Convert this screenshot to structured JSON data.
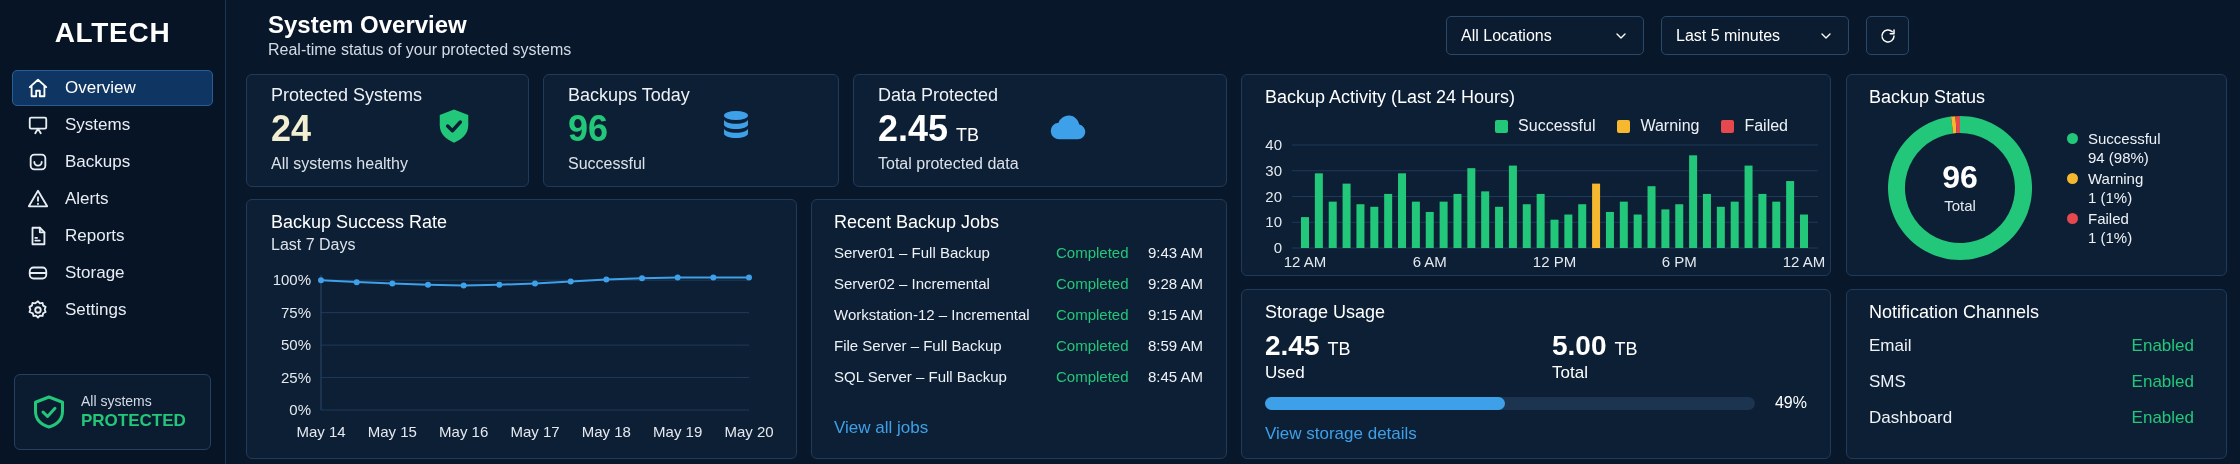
{
  "sidebar": {
    "logo": "ALTECH",
    "items": [
      {
        "label": "Overview",
        "selected": true
      },
      {
        "label": "Systems",
        "selected": false
      },
      {
        "label": "Backups",
        "selected": false
      },
      {
        "label": "Alerts",
        "selected": false
      },
      {
        "label": "Reports",
        "selected": false
      },
      {
        "label": "Storage",
        "selected": false
      },
      {
        "label": "Settings",
        "selected": false
      }
    ],
    "status_card": {
      "label": "All systems",
      "status": "PROTECTED"
    }
  },
  "header": {
    "title": "System Overview",
    "subtitle": "Real-time status of your protected systems",
    "filters": [
      {
        "value": "All Locations"
      },
      {
        "value": "Last 5 minutes"
      }
    ]
  },
  "stat_cards": [
    {
      "kind": "shield",
      "title": "Protected Systems",
      "value": "24",
      "color": "#f2eed2",
      "caption": "All systems healthy"
    },
    {
      "kind": "database",
      "title": "Backups Today",
      "value": "96",
      "color": "#22c77a",
      "caption": "Successful"
    },
    {
      "kind": "cloud",
      "title": "Data Protected",
      "value": "2.45",
      "unit": "TB",
      "color": "#ffffff",
      "caption": "Total protected data"
    }
  ],
  "success_rate": {
    "title": "Backup Success Rate",
    "subtitle": "Last 7 Days",
    "chart_data": {
      "type": "line",
      "categories": [
        "May 14",
        null,
        "May 15",
        null,
        "May 16",
        null,
        "May 17",
        null,
        "May 18",
        null,
        "May 19",
        null,
        "May 20"
      ],
      "grid": true,
      "series": [
        {
          "color": "#3ea0e8",
          "marker": "circle",
          "values": [
            100,
            98.5,
            97.5,
            96.5,
            96,
            96.5,
            97.5,
            99,
            100.5,
            101.5,
            102,
            102,
            102
          ]
        }
      ],
      "ylim": [
        0,
        104
      ],
      "yticks": [
        {
          "value": 0,
          "label": "0%"
        },
        {
          "value": 25,
          "label": "25%"
        },
        {
          "value": 50,
          "label": "50%"
        },
        {
          "value": 75,
          "label": "75%"
        },
        {
          "value": 100,
          "label": "100%"
        }
      ]
    }
  },
  "recent_jobs": {
    "title": "Recent Backup Jobs",
    "jobs": [
      {
        "name": "Server01 – Full Backup",
        "status": "Completed",
        "time": "9:43 AM"
      },
      {
        "name": "Server02 – Incremental",
        "status": "Completed",
        "time": "9:28 AM"
      },
      {
        "name": "Workstation-12 – Incremental",
        "status": "Completed",
        "time": "9:15 AM"
      },
      {
        "name": "File Server – Full Backup",
        "status": "Completed",
        "time": "8:59 AM"
      },
      {
        "name": "SQL Server – Full Backup",
        "status": "Completed",
        "time": "8:45 AM"
      }
    ],
    "link": "View all jobs"
  },
  "backup_activity": {
    "title": "Backup Activity (Last 24 Hours)",
    "chart_data": {
      "type": "bar",
      "stacked": true,
      "categories": [
        "12 AM",
        null,
        null,
        null,
        null,
        null,
        null,
        null,
        null,
        "6 AM",
        null,
        null,
        null,
        null,
        null,
        null,
        null,
        null,
        "12 PM",
        null,
        null,
        null,
        null,
        null,
        null,
        null,
        null,
        "6 PM",
        null,
        null,
        null,
        null,
        null,
        null,
        null,
        null,
        "12 AM"
      ],
      "series": [
        {
          "name": "Successful",
          "color": "#22c77a",
          "values": [
            12,
            29,
            18,
            25,
            17,
            16,
            21,
            29,
            18,
            14,
            18,
            21,
            31,
            22,
            16,
            32,
            17,
            21,
            11,
            13,
            17,
            0,
            14,
            18,
            13,
            24,
            15,
            17,
            36,
            21,
            16,
            18,
            32,
            21,
            18,
            26,
            13
          ]
        },
        {
          "name": "Warning",
          "color": "#f5b82e",
          "values": [
            0,
            0,
            0,
            0,
            0,
            0,
            0,
            0,
            0,
            0,
            0,
            0,
            0,
            0,
            0,
            0,
            0,
            0,
            0,
            0,
            0,
            25,
            0,
            0,
            0,
            0,
            0,
            0,
            0,
            0,
            0,
            0,
            0,
            0,
            0,
            0,
            0
          ]
        },
        {
          "name": "Failed",
          "color": "#e5484d",
          "values": [
            0,
            0,
            0,
            0,
            0,
            0,
            0,
            0,
            0,
            0,
            0,
            0,
            0,
            0,
            0,
            0,
            0,
            0,
            0,
            0,
            0,
            0,
            0,
            0,
            0,
            0,
            0,
            0,
            0,
            0,
            0,
            0,
            0,
            0,
            0,
            0,
            0
          ]
        }
      ],
      "ylim": [
        0,
        40
      ],
      "yticks": [
        0,
        10,
        20,
        30,
        40
      ],
      "grid": true
    }
  },
  "backup_status": {
    "title": "Backup Status",
    "total": "96",
    "total_label": "Total",
    "chart_data": {
      "type": "donut",
      "categories": [
        "Successful",
        "Warning",
        "Failed"
      ],
      "values": [
        98,
        1,
        1
      ]
    },
    "legend": [
      {
        "detail": "94 (98%)",
        "color": "#22c77a"
      },
      {
        "detail": "1 (1%)",
        "color": "#f5b82e"
      },
      {
        "detail": "1 (1%)",
        "color": "#e5484d"
      }
    ]
  },
  "storage_usage": {
    "title": "Storage Usage",
    "used": {
      "value": "2.45",
      "unit": "TB",
      "label": "Used"
    },
    "total": {
      "value": "5.00",
      "unit": "TB",
      "label": "Total"
    },
    "level": 0.49,
    "percent": "49%",
    "link": "View storage details"
  },
  "notification_channels": {
    "title": "Notification Channels",
    "channels": [
      {
        "name": "Email",
        "status": "Enabled",
        "enabled": true
      },
      {
        "name": "SMS",
        "status": "Enabled",
        "enabled": true
      },
      {
        "name": "Dashboard",
        "status": "Enabled",
        "enabled": true
      }
    ]
  }
}
